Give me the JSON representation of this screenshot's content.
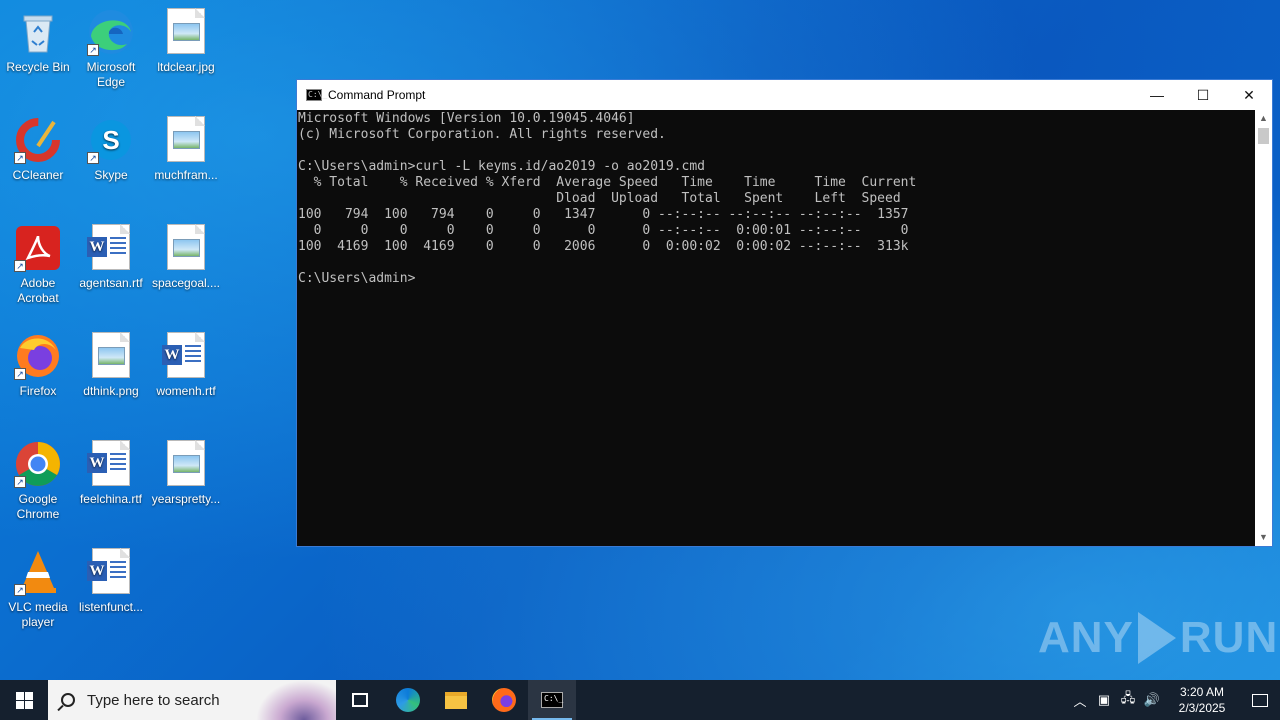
{
  "desktop": {
    "icons": [
      {
        "label": "Recycle Bin",
        "icon": "recycle-bin-icon"
      },
      {
        "label": "Microsoft Edge",
        "icon": "edge-icon"
      },
      {
        "label": "ltdclear.jpg",
        "icon": "image-file-icon"
      },
      {
        "label": "CCleaner",
        "icon": "ccleaner-icon"
      },
      {
        "label": "Skype",
        "icon": "skype-icon"
      },
      {
        "label": "muchfram...",
        "icon": "image-file-icon"
      },
      {
        "label": "Adobe Acrobat",
        "icon": "acrobat-icon"
      },
      {
        "label": "agentsan.rtf",
        "icon": "word-doc-icon"
      },
      {
        "label": "spacegoal....",
        "icon": "image-file-icon"
      },
      {
        "label": "Firefox",
        "icon": "firefox-icon"
      },
      {
        "label": "dthink.png",
        "icon": "image-file-icon"
      },
      {
        "label": "womenh.rtf",
        "icon": "word-doc-icon"
      },
      {
        "label": "Google Chrome",
        "icon": "chrome-icon"
      },
      {
        "label": "feelchina.rtf",
        "icon": "word-doc-icon"
      },
      {
        "label": "yearspretty...",
        "icon": "image-file-icon"
      },
      {
        "label": "VLC media player",
        "icon": "vlc-icon"
      },
      {
        "label": "listenfunct...",
        "icon": "word-doc-icon"
      }
    ]
  },
  "cmd": {
    "title": "Command Prompt",
    "icon_text": "C:\\_",
    "lines": [
      "Microsoft Windows [Version 10.0.19045.4046]",
      "(c) Microsoft Corporation. All rights reserved.",
      "",
      "C:\\Users\\admin>curl -L keyms.id/ao2019 -o ao2019.cmd",
      "  % Total    % Received % Xferd  Average Speed   Time    Time     Time  Current",
      "                                 Dload  Upload   Total   Spent    Left  Speed",
      "100   794  100   794    0     0   1347      0 --:--:-- --:--:-- --:--:--  1357",
      "  0     0    0     0    0     0      0      0 --:--:--  0:00:01 --:--:--     0",
      "100  4169  100  4169    0     0   2006      0  0:00:02  0:00:02 --:--:--  313k",
      "",
      "C:\\Users\\admin>"
    ],
    "minimize": "—",
    "maximize": "☐",
    "close": "✕"
  },
  "watermark": {
    "left": "ANY",
    "right": "RUN"
  },
  "taskbar": {
    "search_placeholder": "Type here to search",
    "clock_time": "3:20 AM",
    "clock_date": "2/3/2025"
  },
  "colors": {
    "console_text": "#c0c0c0",
    "taskbar": "#15202e",
    "accent": "#76b9ed"
  }
}
